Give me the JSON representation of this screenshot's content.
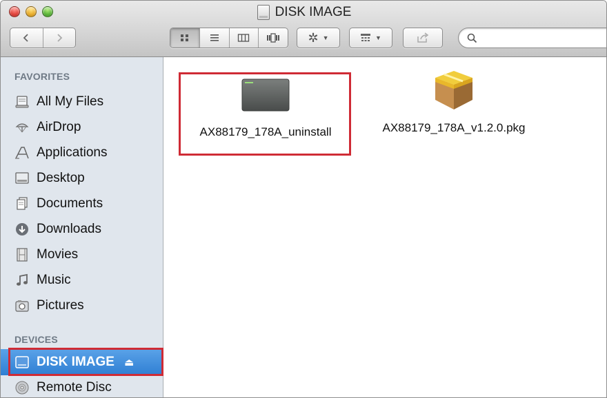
{
  "window": {
    "title": "DISK IMAGE"
  },
  "toolbar": {
    "nav_back_label": "back",
    "nav_forward_label": "forward",
    "view_modes": [
      "icon-view",
      "list-view",
      "column-view",
      "cover-flow-view"
    ],
    "active_view": "icon-view",
    "action_menu_label": "action",
    "arrange_menu_label": "arrange",
    "share_label": "share"
  },
  "search": {
    "value": "",
    "placeholder": ""
  },
  "sidebar": {
    "favorites_heading": "FAVORITES",
    "favorites": [
      {
        "label": "All My Files",
        "icon": "all-my-files-icon"
      },
      {
        "label": "AirDrop",
        "icon": "airdrop-icon"
      },
      {
        "label": "Applications",
        "icon": "applications-icon"
      },
      {
        "label": "Desktop",
        "icon": "desktop-icon"
      },
      {
        "label": "Documents",
        "icon": "documents-icon"
      },
      {
        "label": "Downloads",
        "icon": "downloads-icon"
      },
      {
        "label": "Movies",
        "icon": "movies-icon"
      },
      {
        "label": "Music",
        "icon": "music-icon"
      },
      {
        "label": "Pictures",
        "icon": "pictures-icon"
      }
    ],
    "devices_heading": "DEVICES",
    "devices": [
      {
        "label": "DISK IMAGE",
        "icon": "disk-image-icon",
        "selected": true
      },
      {
        "label": "Remote Disc",
        "icon": "remote-disc-icon",
        "selected": false
      }
    ]
  },
  "files": [
    {
      "label": "AX88179_178A_uninstall",
      "icon": "terminal-script-icon",
      "highlighted": true
    },
    {
      "label": "AX88179_178A_v1.2.0.pkg",
      "icon": "package-icon",
      "highlighted": false
    }
  ],
  "colors": {
    "sidebar_bg": "#e0e6ed",
    "selection_blue": "#3b8ad9",
    "highlight_red": "#cf2b35"
  }
}
